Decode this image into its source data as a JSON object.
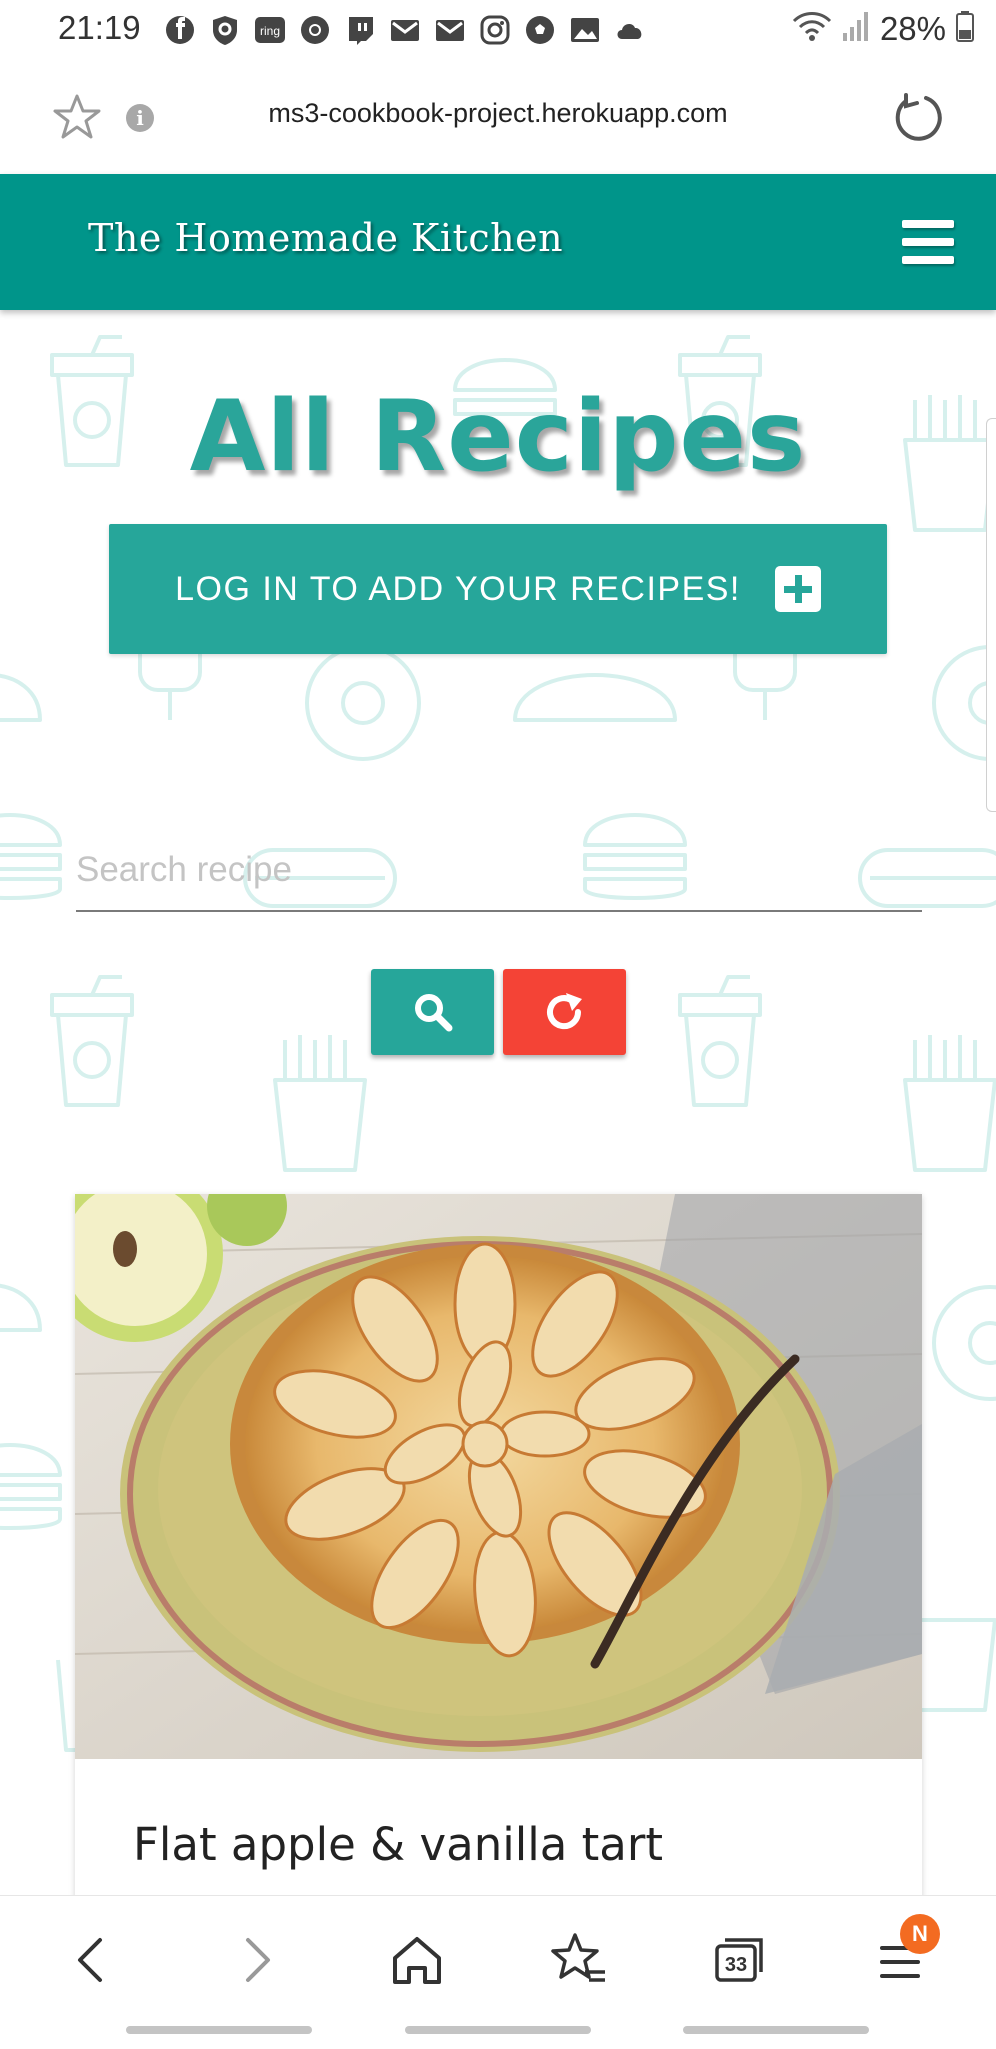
{
  "status_bar": {
    "time": "21:19",
    "battery": "28%",
    "notification_icons": [
      "facebook-icon",
      "shield-icon",
      "ring-icon",
      "chrome-icon",
      "twitch-icon",
      "mail-icon",
      "mail-icon",
      "instagram-icon",
      "soccer-icon",
      "gallery-icon",
      "cloud-icon"
    ]
  },
  "browser": {
    "url": "ms3-cookbook-project.herokuapp.com",
    "tab_count": "33",
    "menu_badge": "N"
  },
  "navbar": {
    "brand": "The Homemade Kitchen"
  },
  "page": {
    "title": "All Recipes",
    "login_button": "LOG IN TO ADD YOUR RECIPES!",
    "search_placeholder": "Search recipe"
  },
  "recipes": [
    {
      "title": "Flat apple & vanilla tart"
    }
  ],
  "colors": {
    "teal": "#00958a",
    "button_teal": "#26a69a",
    "reset_red": "#f44336",
    "badge_orange": "#f36b21"
  }
}
